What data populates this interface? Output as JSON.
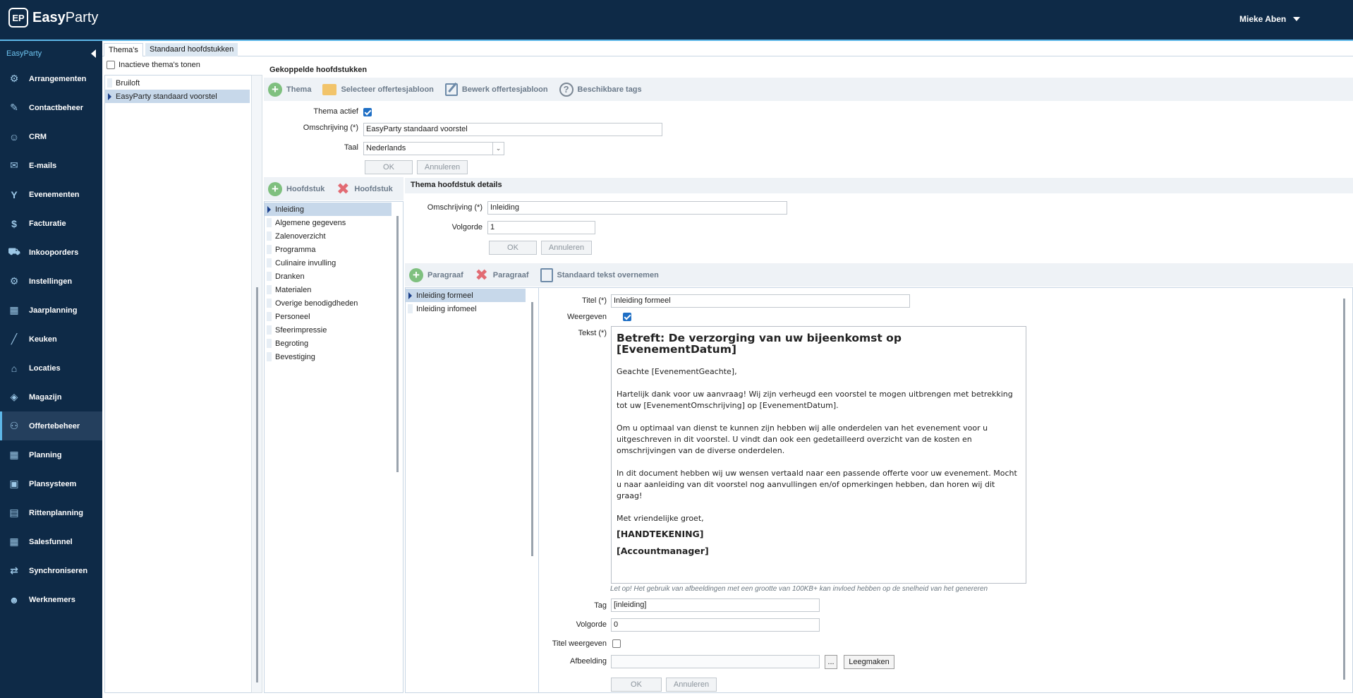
{
  "app": {
    "logo_mark": "EP",
    "name_bold": "Easy",
    "name_rest": "Party",
    "user": "Mieke Aben"
  },
  "sidebar": {
    "header": "EasyParty",
    "items": [
      {
        "label": "Arrangementen",
        "icon": "arrangements-icon",
        "glyph": "⚙"
      },
      {
        "label": "Contactbeheer",
        "icon": "contact-edit-icon",
        "glyph": "✎"
      },
      {
        "label": "CRM",
        "icon": "crm-icon",
        "glyph": "☺"
      },
      {
        "label": "E-mails",
        "icon": "envelope-icon",
        "glyph": "✉"
      },
      {
        "label": "Evenementen",
        "icon": "cocktail-icon",
        "glyph": "Y"
      },
      {
        "label": "Facturatie",
        "icon": "invoice-icon",
        "glyph": "$"
      },
      {
        "label": "Inkooporders",
        "icon": "cart-icon",
        "glyph": "⛟"
      },
      {
        "label": "Instellingen",
        "icon": "gear-icon",
        "glyph": "⚙"
      },
      {
        "label": "Jaarplanning",
        "icon": "calendar-icon",
        "glyph": "▦"
      },
      {
        "label": "Keuken",
        "icon": "knife-icon",
        "glyph": "╱"
      },
      {
        "label": "Locaties",
        "icon": "buildings-icon",
        "glyph": "⌂"
      },
      {
        "label": "Magazijn",
        "icon": "box-icon",
        "glyph": "◈"
      },
      {
        "label": "Offertebeheer",
        "icon": "quote-icon",
        "glyph": "⚇"
      },
      {
        "label": "Planning",
        "icon": "planning-calendar-icon",
        "glyph": "▦"
      },
      {
        "label": "Plansysteem",
        "icon": "plansystem-icon",
        "glyph": "▣"
      },
      {
        "label": "Rittenplanning",
        "icon": "bus-icon",
        "glyph": "▤"
      },
      {
        "label": "Salesfunnel",
        "icon": "funnel-icon",
        "glyph": "▦"
      },
      {
        "label": "Synchroniseren",
        "icon": "sync-icon",
        "glyph": "⇄"
      },
      {
        "label": "Werknemers",
        "icon": "employee-icon",
        "glyph": "☻"
      }
    ],
    "active_index": 12
  },
  "tabs": [
    "Thema's",
    "Standaard hoofdstukken"
  ],
  "themes": {
    "inactive_label": "Inactieve thema's tonen",
    "items": [
      "Bruiloft",
      "EasyParty standaard voorstel"
    ],
    "selected": 1
  },
  "linked": {
    "title": "Gekoppelde hoofdstukken",
    "toolbar": [
      "Thema",
      "Selecteer offertesjabloon",
      "Bewerk offertesjabloon",
      "Beschikbare tags"
    ],
    "active_label": "Thema actief",
    "desc_label": "Omschrijving (*)",
    "desc_value": "EasyParty standaard voorstel",
    "lang_label": "Taal",
    "lang_value": "Nederlands",
    "ok": "OK",
    "cancel": "Annuleren"
  },
  "chapters": {
    "toolbar_add": "Hoofdstuk",
    "toolbar_remove": "Hoofdstuk",
    "items": [
      "Inleiding",
      "Algemene gegevens",
      "Zalenoverzicht",
      "Programma",
      "Culinaire invulling",
      "Dranken",
      "Materialen",
      "Overige benodigdheden",
      "Personeel",
      "Sfeerimpressie",
      "Begroting",
      "Bevestiging"
    ],
    "selected": 0
  },
  "chapter_detail": {
    "title": "Thema hoofdstuk details",
    "desc_label": "Omschrijving (*)",
    "desc_value": "Inleiding",
    "order_label": "Volgorde",
    "order_value": "1",
    "ok": "OK",
    "cancel": "Annuleren"
  },
  "paragraphs": {
    "toolbar": [
      "Paragraaf",
      "Paragraaf",
      "Standaard tekst overnemen"
    ],
    "items": [
      "Inleiding formeel",
      "Inleiding infomeel"
    ],
    "selected": 0
  },
  "paragraph_detail": {
    "title_label": "Titel (*)",
    "title_value": "Inleiding formeel",
    "show_label": "Weergeven",
    "text_label": "Tekst (*)",
    "text_heading": "Betreft: De verzorging van uw bijeenkomst op [EvenementDatum]",
    "text_p1": "Geachte [EvenementGeachte],",
    "text_p2": "Hartelijk dank voor uw aanvraag! Wij zijn verheugd een voorstel te mogen uitbrengen met betrekking tot uw [EvenementOmschrijving] op [EvenementDatum].",
    "text_p3": "Om u optimaal van dienst te kunnen zijn hebben wij alle onderdelen van het evenement voor u uitgeschreven in dit voorstel. U vindt dan ook een gedetailleerd overzicht van de kosten en omschrijvingen van de diverse onderdelen.",
    "text_p4": "In dit document hebben wij uw wensen vertaald naar een passende offerte voor uw evenement. Mocht u naar aanleiding van dit voorstel nog aanvullingen en/of opmerkingen hebben, dan horen wij dit graag!",
    "text_p5": "Met vriendelijke groet,",
    "text_sig": "[HANDTEKENING]",
    "text_mgr": "[Accountmanager]",
    "warning": "Let op! Het gebruik van afbeeldingen met een grootte van 100KB+ kan invloed hebben op de snelheid van het genereren",
    "tag_label": "Tag",
    "tag_value": "[inleiding]",
    "order_label": "Volgorde",
    "order_value": "0",
    "showtitle_label": "Titel weergeven",
    "image_label": "Afbeelding",
    "browse": "...",
    "clear": "Leegmaken",
    "ok": "OK",
    "cancel": "Annuleren"
  }
}
